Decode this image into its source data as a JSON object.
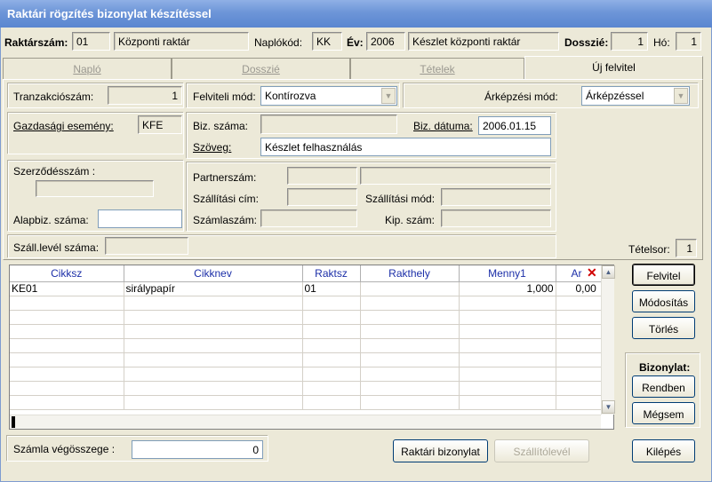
{
  "window": {
    "title": "Raktári rögzítés bizonylat készítéssel"
  },
  "header": {
    "raktarszam_label": "Raktárszám:",
    "raktarszam": "01",
    "raktar_nev": "Központi raktár",
    "naplokod_label": "Naplókód:",
    "naplokod": "KK",
    "ev_label": "Év:",
    "ev": "2006",
    "ev_nev": "Készlet központi raktár",
    "dosszie_label": "Dosszié:",
    "dosszie": "1",
    "ho_label": "Hó:",
    "ho": "1"
  },
  "tabs": [
    {
      "label": "Napló"
    },
    {
      "label": "Dosszié"
    },
    {
      "label": "Tételek"
    },
    {
      "label": "Új felvitel"
    }
  ],
  "form": {
    "tranzakcioszam_label": "Tranzakciószám:",
    "tranzakcioszam": "1",
    "felviteli_mod_label": "Felviteli mód:",
    "felviteli_mod": "Kontírozva",
    "arkepzesi_mod_label": "Árképzési mód:",
    "arkepzesi_mod": "Árképzéssel",
    "gazdasagi_esemeny_label": "Gazdasági esemény:",
    "gazdasagi_esemeny": "KFE",
    "biz_szama_label": "Biz. száma:",
    "biz_szama": "",
    "biz_datuma_label": "Biz. dátuma:",
    "biz_datuma": "2006.01.15",
    "szoveg_label": "Szöveg:",
    "szoveg": "Készlet felhasználás",
    "szerzodesszam_label": "Szerződésszám :",
    "szerzodesszam": "",
    "partnerszam_label": "Partnerszám:",
    "szallitasi_cim_label": "Szállítási cím:",
    "szallitasi_mod_label": "Szállítási mód:",
    "alapbiz_label": "Alapbiz. száma:",
    "szamlaszam_label": "Számlaszám:",
    "kip_szam_label": "Kip. szám:",
    "szall_level_label": "Száll.levél száma:"
  },
  "grid": {
    "columns": [
      "Cikksz",
      "Cikknev",
      "Raktsz",
      "Rakthely",
      "Menny1",
      "Ar"
    ],
    "rows": [
      [
        "KE01",
        "sirálypapír",
        "01",
        "",
        "1,000",
        "0,00"
      ]
    ]
  },
  "side": {
    "tetelsor_label": "Tételsor:",
    "tetelsor": "1",
    "felvitel": "Felvitel",
    "modositas": "Módosítás",
    "torles": "Törlés",
    "bizonylat_label": "Bizonylat:",
    "rendben": "Rendben",
    "megsem": "Mégsem"
  },
  "footer": {
    "szamla_vegosszeg_label": "Számla végösszege :",
    "szamla_vegosszeg": "0",
    "raktari_bizonylat": "Raktári bizonylat",
    "szallitolevel": "Szállítólevél",
    "kilepes": "Kilépés"
  }
}
